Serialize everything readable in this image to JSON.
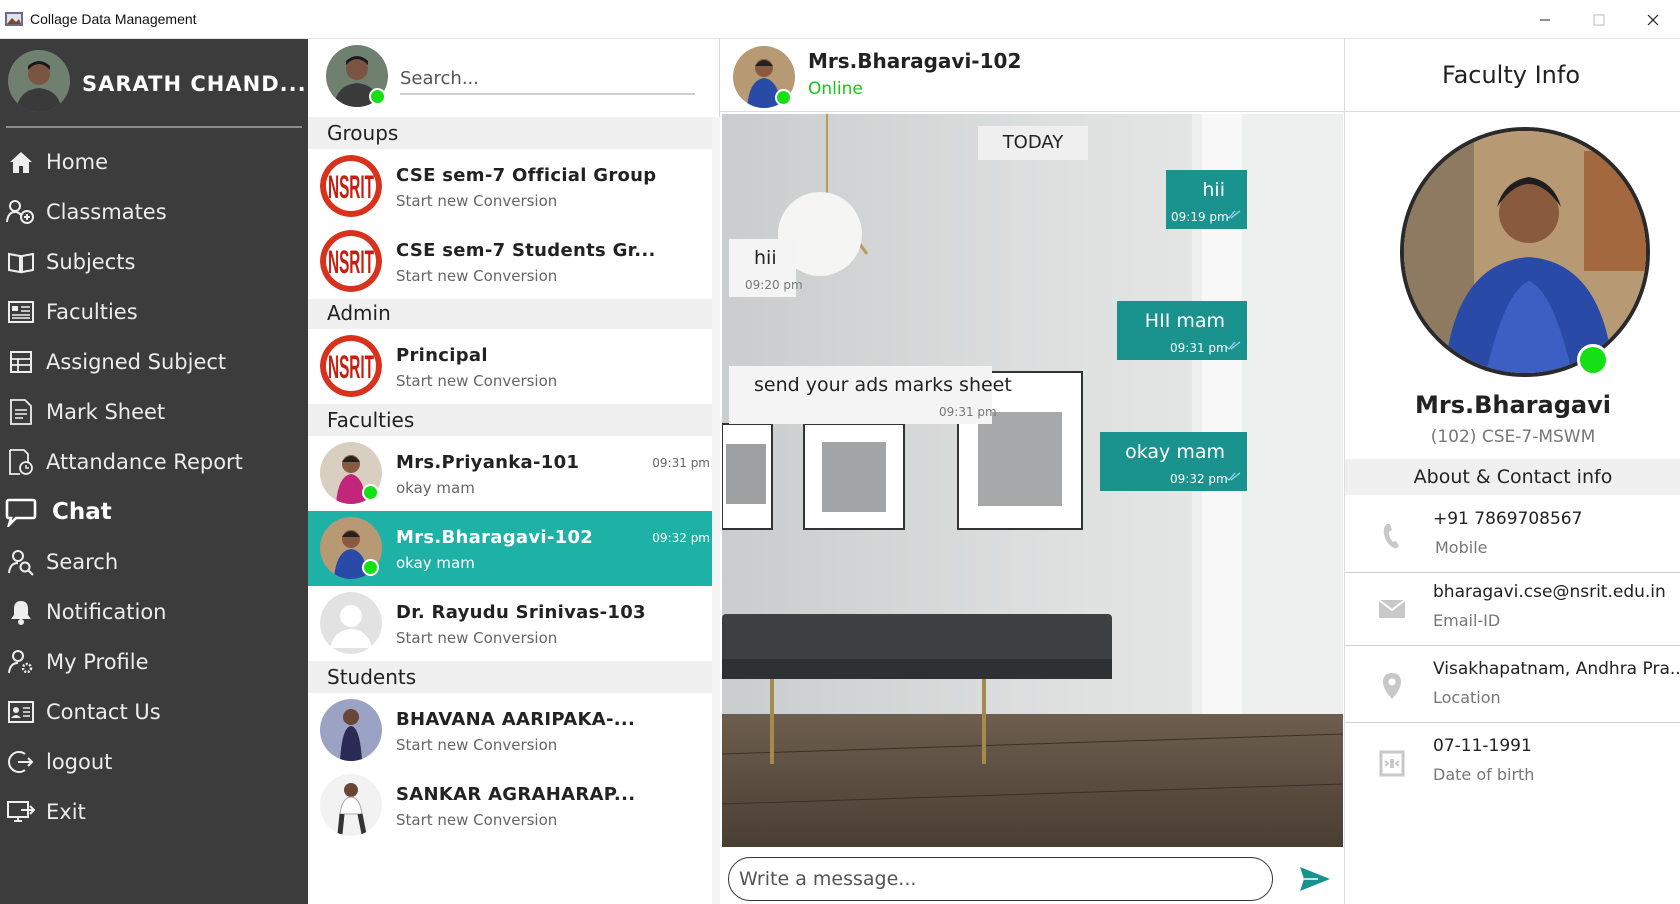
{
  "window": {
    "title": "Collage Data Management",
    "minimize_icon": "minimize-icon",
    "maximize_icon": "maximize-icon",
    "close_icon": "close-icon"
  },
  "sidebar": {
    "user_name": "SARATH CHAND...",
    "items": [
      {
        "label": "Home",
        "icon": "home-icon"
      },
      {
        "label": "Classmates",
        "icon": "classmates-icon"
      },
      {
        "label": "Subjects",
        "icon": "book-icon"
      },
      {
        "label": "Faculties",
        "icon": "faculties-icon"
      },
      {
        "label": "Assigned Subject",
        "icon": "assigned-subject-icon"
      },
      {
        "label": "Mark Sheet",
        "icon": "mark-sheet-icon"
      },
      {
        "label": "Attandance Report",
        "icon": "report-icon"
      },
      {
        "label": "Chat",
        "icon": "chat-icon",
        "active": true
      },
      {
        "label": "Search",
        "icon": "search-user-icon"
      },
      {
        "label": "Notification",
        "icon": "bell-icon"
      },
      {
        "label": "My Profile",
        "icon": "profile-settings-icon"
      },
      {
        "label": "Contact Us",
        "icon": "contact-card-icon"
      },
      {
        "label": "logout",
        "icon": "logout-icon"
      },
      {
        "label": "Exit",
        "icon": "exit-icon"
      }
    ]
  },
  "contacts": {
    "search_placeholder": "Search...",
    "sections": {
      "groups": "Groups",
      "admin": "Admin",
      "faculties": "Faculties",
      "students": "Students"
    },
    "groups": [
      {
        "name": "CSE sem-7 Official Group",
        "sub": "Start new Conversion"
      },
      {
        "name": "CSE sem-7 Students Gr...",
        "sub": "Start new Conversion"
      }
    ],
    "admin": [
      {
        "name": "Principal",
        "sub": "Start new Conversion"
      }
    ],
    "faculties": [
      {
        "name": "Mrs.Priyanka-101",
        "sub": "okay mam",
        "time": "09:31 pm"
      },
      {
        "name": "Mrs.Bharagavi-102",
        "sub": "okay mam",
        "time": "09:32 pm"
      },
      {
        "name": "Dr. Rayudu Srinivas-103",
        "sub": "Start new Conversion"
      }
    ],
    "students": [
      {
        "name": "BHAVANA AARIPAKA-...",
        "sub": "Start new Conversion"
      },
      {
        "name": "SANKAR AGRAHARAP...",
        "sub": "Start new Conversion"
      }
    ],
    "logo_text": "NSRIT"
  },
  "chat": {
    "name": "Mrs.Bharagavi-102",
    "status": "Online",
    "day_label": "TODAY",
    "messages": [
      {
        "dir": "out",
        "text": "hii",
        "time": "09:19 pm"
      },
      {
        "dir": "in",
        "text": "hii",
        "time": "09:20 pm"
      },
      {
        "dir": "out",
        "text": "HII mam",
        "time": "09:31 pm"
      },
      {
        "dir": "in",
        "text": "send your ads marks sheet",
        "time": "09:31 pm"
      },
      {
        "dir": "out",
        "text": "okay mam",
        "time": "09:32 pm"
      }
    ],
    "input_placeholder": "Write a message...",
    "send_icon": "send-icon"
  },
  "info": {
    "title": "Faculty Info",
    "name": "Mrs.Bharagavi",
    "id_line": "(102) CSE-7-MSWM",
    "about_title": "About & Contact info",
    "rows": [
      {
        "value": "+91 7869708567",
        "label": "Mobile",
        "icon": "phone-icon"
      },
      {
        "value": "bharagavi.cse@nsrit.edu.in",
        "label": "Email-ID",
        "icon": "mail-icon"
      },
      {
        "value": "Visakhapatnam, Andhra Pra...",
        "label": "Location",
        "icon": "location-icon"
      },
      {
        "value": "07-11-1991",
        "label": "Date of birth",
        "icon": "calendar-icon"
      }
    ]
  },
  "colors": {
    "sidebar_bg": "#3c3c3c",
    "accent_teal": "#1eb2a6",
    "bubble_out": "#1a938f",
    "online_green": "#14e014"
  }
}
